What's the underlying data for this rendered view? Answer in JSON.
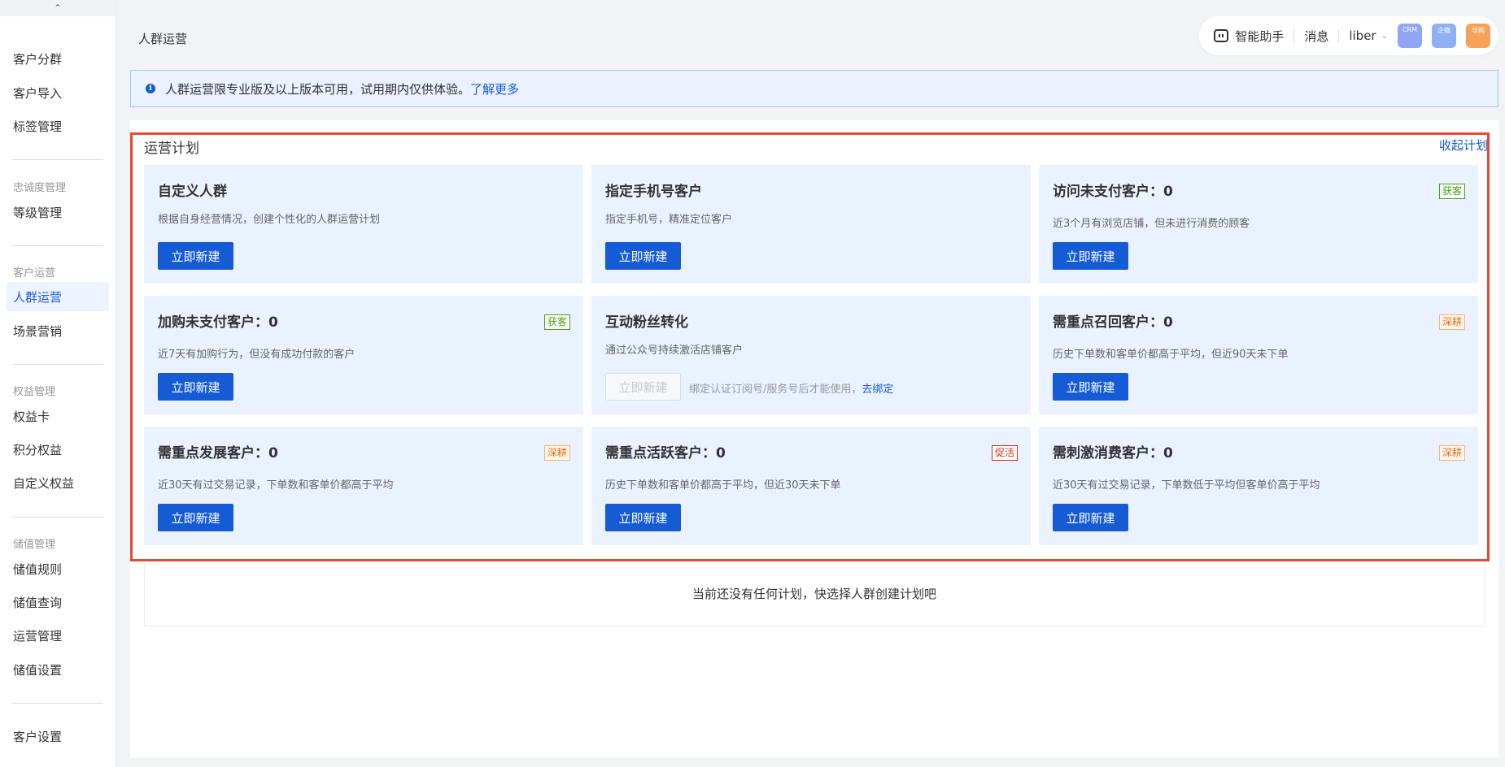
{
  "sidebar": {
    "collapse_icon": "chevron-up-icon",
    "items_top": [
      "客户分群",
      "客户导入",
      "标签管理"
    ],
    "group_loyalty": "忠诚度管理",
    "loyalty_items": [
      "等级管理"
    ],
    "group_ops": "客户运营",
    "ops_items": [
      "人群运营",
      "场景营销"
    ],
    "active_item": "人群运营",
    "group_rights": "权益管理",
    "rights_items": [
      "权益卡",
      "积分权益",
      "自定义权益"
    ],
    "group_stored": "储值管理",
    "stored_items": [
      "储值规则",
      "储值查询",
      "运营管理",
      "储值设置"
    ],
    "bottom_items": [
      "客户设置"
    ]
  },
  "header": {
    "page_title": "人群运营",
    "assistant_label": "智能助手",
    "messages_label": "消息",
    "user_name": "liber",
    "apps": [
      {
        "label": "CRM",
        "color": "#8fa6f5"
      },
      {
        "label": "企微",
        "color": "#8fb0f5"
      },
      {
        "label": "导购",
        "color": "#f6a25b"
      }
    ]
  },
  "notice": {
    "text": "人群运营限专业版及以上版本可用，试用期内仅供体验。",
    "link": "了解更多"
  },
  "plans": {
    "title": "运营计划",
    "collapse_label": "收起计划",
    "cards": [
      {
        "title": "自定义人群",
        "desc": "根据自身经营情况，创建个性化的人群运营计划",
        "tag": "",
        "button": "立即新建",
        "disabled": false
      },
      {
        "title": "指定手机号客户",
        "desc": "指定手机号，精准定位客户",
        "tag": "",
        "button": "立即新建",
        "disabled": false
      },
      {
        "title": "访问未支付客户：0",
        "desc": "近3个月有浏览店铺，但未进行消费的顾客",
        "tag": "获客",
        "tag_color": "green",
        "button": "立即新建",
        "disabled": false
      },
      {
        "title": "加购未支付客户：0",
        "desc": "近7天有加购行为，但没有成功付款的客户",
        "tag": "获客",
        "tag_color": "green",
        "button": "立即新建",
        "disabled": false
      },
      {
        "title": "互动粉丝转化",
        "desc": "通过公众号持续激活店铺客户",
        "tag": "",
        "button": "立即新建",
        "disabled": true,
        "hint": "绑定认证订阅号/服务号后才能使用，",
        "hint_link": "去绑定"
      },
      {
        "title": "需重点召回客户：0",
        "desc": "历史下单数和客单价都高于平均，但近90天未下单",
        "tag": "深耕",
        "tag_color": "orange",
        "button": "立即新建",
        "disabled": false
      },
      {
        "title": "需重点发展客户：0",
        "desc": "近30天有过交易记录，下单数和客单价都高于平均",
        "tag": "深耕",
        "tag_color": "orange",
        "button": "立即新建",
        "disabled": false
      },
      {
        "title": "需重点活跃客户：0",
        "desc": "历史下单数和客单价都高于平均，但近30天未下单",
        "tag": "促活",
        "tag_color": "red",
        "button": "立即新建",
        "disabled": false
      },
      {
        "title": "需刺激消费客户：0",
        "desc": "近30天有过交易记录，下单数低于平均但客单价高于平均",
        "tag": "深耕",
        "tag_color": "orange",
        "button": "立即新建",
        "disabled": false
      }
    ],
    "empty_text": "当前还没有任何计划，快选择人群创建计划吧"
  }
}
